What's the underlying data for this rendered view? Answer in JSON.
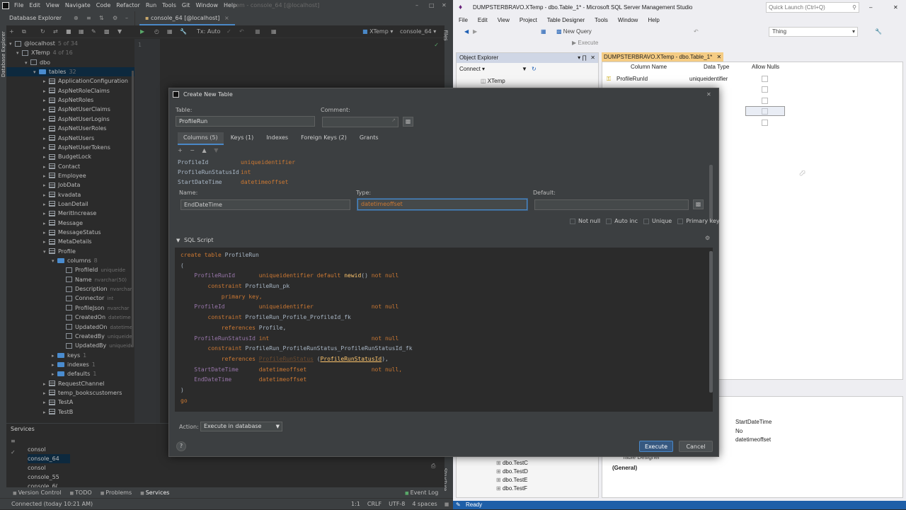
{
  "ide": {
    "menu": [
      "File",
      "Edit",
      "View",
      "Navigate",
      "Code",
      "Refactor",
      "Run",
      "Tools",
      "Git",
      "Window",
      "Help"
    ],
    "title_dim": "tem - console_64 [@localhost]",
    "db_panel_title": "Database Explorer",
    "side_tab": "Database Explorer",
    "editor_tab": "console_64 [@localhost]",
    "tx_label": "Tx: Auto",
    "schema_sel": "XTemp",
    "console_sel": "console_64",
    "line_no": "1",
    "tree": {
      "host": "@localhost",
      "host_count": "5 of 34",
      "db": "XTemp",
      "db_count": "4 of 16",
      "schema": "dbo",
      "tables_label": "tables",
      "tables_count": "32",
      "tables_before": [
        "ApplicationConfiguration",
        "AspNetRoleClaims",
        "AspNetRoles",
        "AspNetUserClaims",
        "AspNetUserLogins",
        "AspNetUserRoles",
        "AspNetUsers",
        "AspNetUserTokens",
        "BudgetLock",
        "Contact",
        "Employee",
        "JobData",
        "kvadata",
        "LoanDetail",
        "MeritIncrease",
        "Message",
        "MessageStatus",
        "MetaDetails"
      ],
      "profile": "Profile",
      "columns_label": "columns",
      "columns_count": "8",
      "columns": [
        {
          "name": "ProfileId",
          "type": "uniqueide"
        },
        {
          "name": "Name",
          "type": "nvarchar(50)"
        },
        {
          "name": "Description",
          "type": "nvarchar"
        },
        {
          "name": "Connector",
          "type": "int"
        },
        {
          "name": "ProfileJson",
          "type": "nvarchar"
        },
        {
          "name": "CreatedOn",
          "type": "datetime"
        },
        {
          "name": "UpdatedOn",
          "type": "datetime"
        },
        {
          "name": "CreatedBy",
          "type": "uniqueide"
        },
        {
          "name": "UpdatedBy",
          "type": "uniqueide"
        }
      ],
      "sub": [
        {
          "name": "keys",
          "count": "1"
        },
        {
          "name": "indexes",
          "count": "1"
        },
        {
          "name": "defaults",
          "count": "1"
        }
      ],
      "tables_after": [
        "RequestChannel",
        "temp_bookscustomers",
        "TestA",
        "TestB"
      ]
    },
    "services_title": "Services",
    "services": [
      "consol",
      "console_64",
      "consol",
      "console_55",
      "console_6("
    ],
    "bottom_tabs": [
      "Version Control",
      "TODO",
      "Problems",
      "Services"
    ],
    "event_log": "Event Log",
    "status_left": "Connected (today 10:21 AM)",
    "status_right": [
      "1:1",
      "CRLF",
      "UTF-8",
      "4 spaces"
    ],
    "right_strip": [
      "Files",
      "Structure"
    ]
  },
  "ssms": {
    "title": "DUMPSTERBRAVO.XTemp - dbo.Table_1* - Microsoft SQL Server Management Studio",
    "quick_launch": "Quick Launch (Ctrl+Q)",
    "menu": [
      "File",
      "Edit",
      "View",
      "Project",
      "Table Designer",
      "Tools",
      "Window",
      "Help"
    ],
    "new_query": "New Query",
    "execute": "Execute",
    "thing": "Thing",
    "object_explorer": "Object Explorer",
    "connect": "Connect",
    "oe_db": "XTemp",
    "doc_tab": "DUMPSTERBRAVO.XTemp - dbo.Table_1*",
    "grid_headers": [
      "Column Name",
      "Data Type",
      "Allow Nulls"
    ],
    "grid_rows": [
      {
        "name": "ProfileRunId",
        "type": "uniqueidentifier"
      },
      {
        "name": "",
        "type": ""
      },
      {
        "name": "",
        "type": "ifier"
      },
      {
        "name": "",
        "type": "et(7)"
      },
      {
        "name": "",
        "type": ""
      }
    ],
    "oe_items": [
      "dbo.TestC",
      "dbo.TestD",
      "dbo.TestE",
      "dbo.TestF"
    ],
    "props": [
      "StartDateTime",
      "No",
      "datetimeoffset"
    ],
    "props_general": "(General)",
    "props_designer": "Table Designer",
    "status": "Ready"
  },
  "dialog": {
    "title": "Create New Table",
    "table_label": "Table:",
    "table_value": "ProfileRun",
    "comment_label": "Comment:",
    "tabs": [
      "Columns (5)",
      "Keys (1)",
      "Indexes",
      "Foreign Keys (2)",
      "Grants"
    ],
    "columns": [
      {
        "name": "ProfileId",
        "type": "uniqueidentifier"
      },
      {
        "name": "ProfileRunStatusId",
        "type": "int"
      },
      {
        "name": "StartDateTime",
        "type": "datetimeoffset"
      }
    ],
    "name_label": "Name:",
    "name_value": "EndDateTime",
    "type_label": "Type:",
    "type_value": "datetimeoffset",
    "default_label": "Default:",
    "checks": [
      "Not null",
      "Auto inc",
      "Unique",
      "Primary key"
    ],
    "sql_title": "SQL Script",
    "sql_lines": [
      [
        [
          "kw",
          "create table "
        ],
        [
          "id",
          "ProfileRun"
        ]
      ],
      [
        [
          "id",
          "("
        ]
      ],
      [
        [
          "pad",
          "    "
        ],
        [
          "ref",
          "ProfileRunId       "
        ],
        [
          "kw",
          "uniqueidentifier default "
        ],
        [
          "fn",
          "newid"
        ],
        [
          "id",
          "() "
        ],
        [
          "kw",
          "not null"
        ]
      ],
      [
        [
          "pad",
          "        "
        ],
        [
          "kw",
          "constraint "
        ],
        [
          "id",
          "ProfileRun_pk"
        ]
      ],
      [
        [
          "pad",
          "            "
        ],
        [
          "kw",
          "primary key,"
        ]
      ],
      [
        [
          "pad",
          "    "
        ],
        [
          "ref",
          "ProfileId          "
        ],
        [
          "kw",
          "uniqueidentifier                 not null"
        ]
      ],
      [
        [
          "pad",
          "        "
        ],
        [
          "kw",
          "constraint "
        ],
        [
          "id",
          "ProfileRun_Profile_ProfileId_fk"
        ]
      ],
      [
        [
          "pad",
          "            "
        ],
        [
          "kw",
          "references "
        ],
        [
          "id",
          "Profile,"
        ]
      ],
      [
        [
          "pad",
          "    "
        ],
        [
          "ref",
          "ProfileRunStatusId "
        ],
        [
          "kw",
          "int                              not null"
        ]
      ],
      [
        [
          "pad",
          "        "
        ],
        [
          "kw",
          "constraint "
        ],
        [
          "id",
          "ProfileRun_ProfileRunStatus_ProfileRunStatusId_fk"
        ]
      ],
      [
        [
          "pad",
          "            "
        ],
        [
          "kw",
          "references "
        ],
        [
          "err",
          "ProfileRunStatus"
        ],
        [
          "id",
          " ("
        ],
        [
          "fn",
          "ProfileRunStatusId"
        ],
        [
          "id",
          "),"
        ]
      ],
      [
        [
          "pad",
          "    "
        ],
        [
          "ref",
          "StartDateTime      "
        ],
        [
          "kw",
          "datetimeoffset                   not null,"
        ]
      ],
      [
        [
          "pad",
          "    "
        ],
        [
          "ref",
          "EndDateTime        "
        ],
        [
          "kw",
          "datetimeoffset"
        ]
      ],
      [
        [
          "id",
          ")"
        ]
      ],
      [
        [
          "kw",
          "go"
        ]
      ]
    ],
    "action_label": "Action:",
    "action_value": "Execute in database",
    "execute": "Execute",
    "cancel": "Cancel",
    "help": "?"
  }
}
